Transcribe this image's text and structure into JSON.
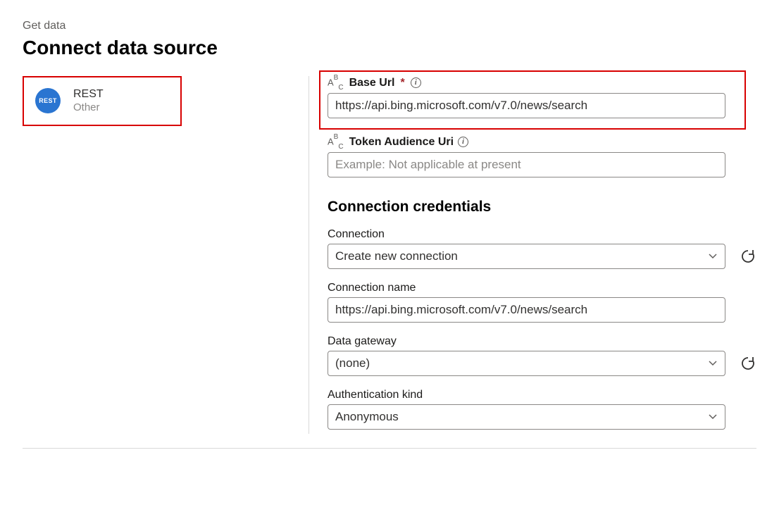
{
  "breadcrumb": "Get data",
  "page_title": "Connect data source",
  "connector": {
    "badge": "REST",
    "title": "REST",
    "subtitle": "Other"
  },
  "base_url": {
    "label": "Base Url",
    "required_marker": "*",
    "type_badge": "ABC",
    "value": "https://api.bing.microsoft.com/v7.0/news/search"
  },
  "token_audience": {
    "label": "Token Audience Uri",
    "type_badge": "ABC",
    "placeholder": "Example: Not applicable at present",
    "value": ""
  },
  "credentials": {
    "heading": "Connection credentials",
    "connection": {
      "label": "Connection",
      "value": "Create new connection"
    },
    "connection_name": {
      "label": "Connection name",
      "value": "https://api.bing.microsoft.com/v7.0/news/search"
    },
    "data_gateway": {
      "label": "Data gateway",
      "value": "(none)"
    },
    "auth_kind": {
      "label": "Authentication kind",
      "value": "Anonymous"
    }
  }
}
